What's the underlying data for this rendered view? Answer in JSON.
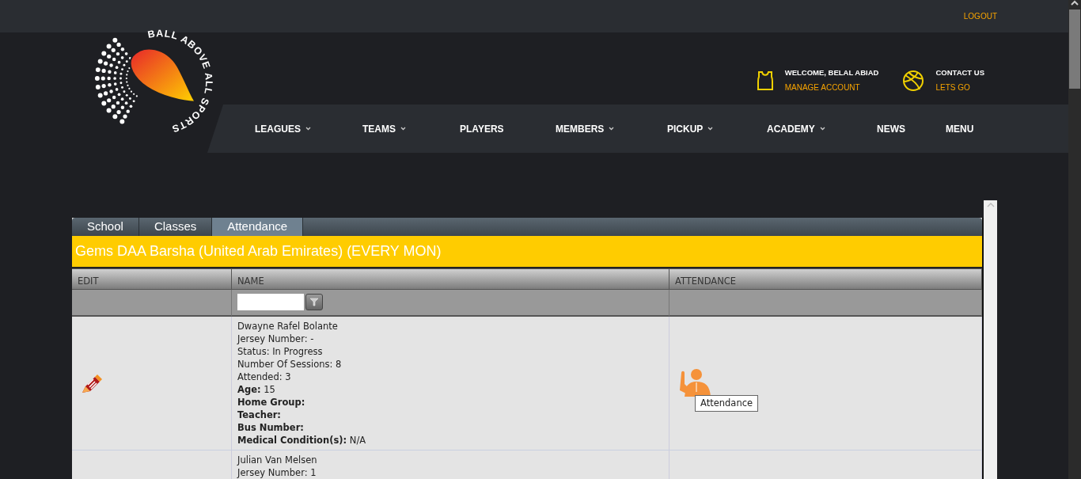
{
  "top_bar": {
    "logout": "LOGOUT"
  },
  "logo": {
    "text": "BALL ABOVE ALL SPORTS"
  },
  "account": {
    "welcome": "WELCOME, BELAL ABIAD",
    "link": "MANAGE ACCOUNT"
  },
  "contact": {
    "title": "CONTACT US",
    "link": "LETS GO"
  },
  "nav": [
    {
      "label": "LEAGUES",
      "dropdown": true
    },
    {
      "label": "TEAMS",
      "dropdown": true
    },
    {
      "label": "PLAYERS",
      "dropdown": false
    },
    {
      "label": "MEMBERS",
      "dropdown": true
    },
    {
      "label": "PICKUP",
      "dropdown": true
    },
    {
      "label": "ACADEMY",
      "dropdown": true
    },
    {
      "label": "NEWS",
      "dropdown": false
    },
    {
      "label": "MENU",
      "dropdown": false
    }
  ],
  "tabs": [
    {
      "label": "School",
      "selected": false
    },
    {
      "label": "Classes",
      "selected": false
    },
    {
      "label": "Attendance",
      "selected": true
    }
  ],
  "panel_title": "Gems DAA Barsha (United Arab Emirates) (EVERY MON)",
  "table": {
    "columns": [
      "EDIT",
      "NAME",
      "ATTENDANCE"
    ],
    "rows": [
      {
        "details": [
          "Dwayne Rafel Bolante",
          "Jersey Number: -",
          "Status: In Progress",
          "Number Of Sessions: 8",
          "Attended: 3",
          "**Age:** 15",
          "**Home Group:**",
          "**Teacher:**",
          "**Bus Number:**",
          "**Medical Condition(s):** N/A"
        ],
        "tooltip": "Attendance"
      },
      {
        "details": [
          "Julian Van Melsen",
          "Jersey Number: 1"
        ]
      }
    ]
  }
}
